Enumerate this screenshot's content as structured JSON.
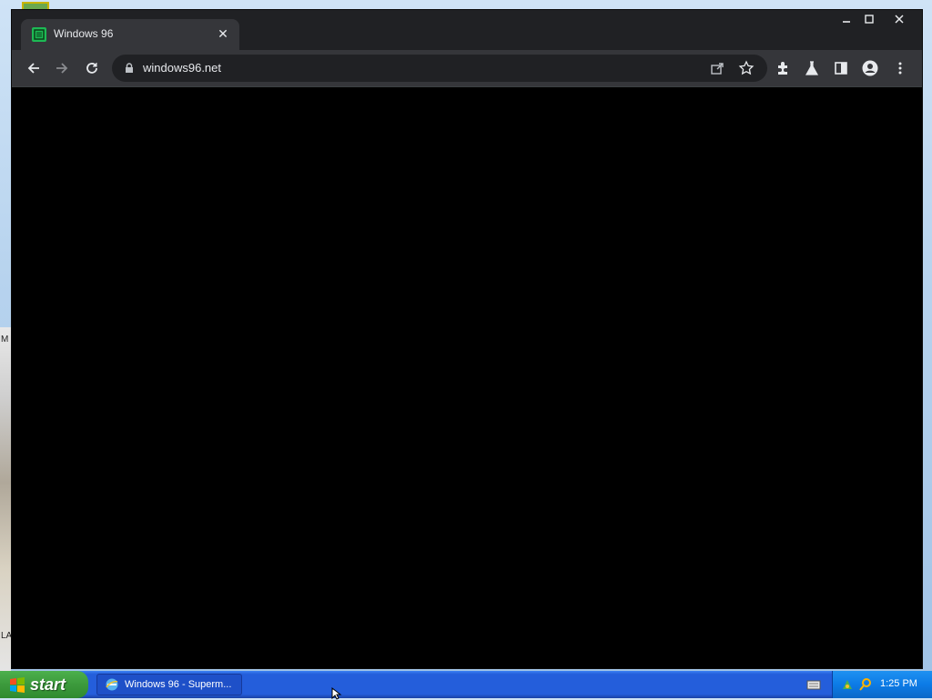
{
  "browser": {
    "tab": {
      "title": "Windows 96",
      "favicon": "windows96-icon"
    },
    "address_bar": {
      "url": "windows96.net"
    },
    "toolbar_icons": [
      "back-icon",
      "forward-icon",
      "reload-icon",
      "lock-icon",
      "share-icon",
      "star-icon",
      "extensions-icon",
      "labs-icon",
      "side-panel-icon",
      "profile-icon",
      "menu-icon"
    ]
  },
  "taskbar": {
    "start_label": "start",
    "task_item_label": "Windows 96 - Superm...",
    "clock": "1:25 PM"
  },
  "desktop": {
    "edge_letters": [
      "M",
      "LA"
    ]
  },
  "colors": {
    "browser_frame": "#202124",
    "toolbar": "#35363a",
    "page_content": "#000000",
    "taskbar_blue": "#245edb",
    "start_green": "#3c9a3c",
    "tray_blue": "#0c7be6"
  }
}
